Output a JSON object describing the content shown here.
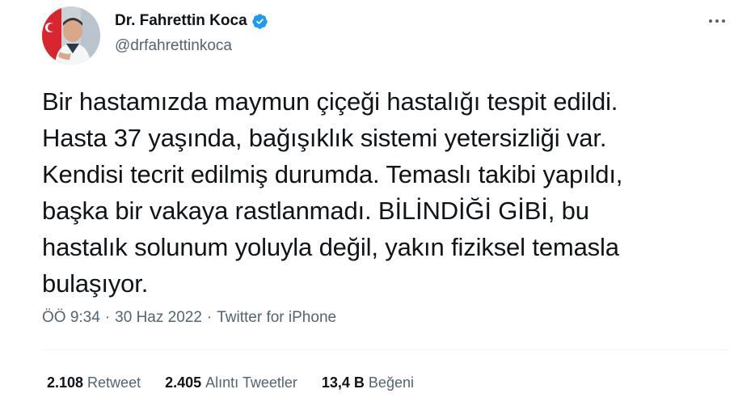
{
  "user": {
    "display_name": "Dr. Fahrettin Koca",
    "handle": "@drfahrettinkoca",
    "verified": true,
    "avatar_icon": "profile-photo"
  },
  "tweet": {
    "text": "Bir hastamızda maymun çiçeği hastalığı tespit edildi.\nHasta 37 yaşında, bağışıklık sistemi yetersizliği var.\nKendisi tecrit edilmiş durumda. Temaslı takibi yapıldı,\nbaşka bir vakaya rastlanmadı. BİLİNDİĞİ GİBİ, bu\nhastalık solunum yoluyla değil, yakın fiziksel temasla\nbulaşıyor.",
    "time": "ÖÖ 9:34",
    "date": "30 Haz 2022",
    "source": "Twitter for iPhone",
    "separator": "·"
  },
  "stats": {
    "retweets": {
      "count": "2.108",
      "label": "Retweet"
    },
    "quotes": {
      "count": "2.405",
      "label": "Alıntı Tweetler"
    },
    "likes": {
      "count": "13,4 B",
      "label": "Beğeni"
    }
  },
  "colors": {
    "text_primary": "#0f1419",
    "text_secondary": "#536471",
    "verified_blue": "#1d9bf0",
    "divider": "#eff3f4"
  },
  "icons": {
    "verified": "verified-badge-icon",
    "more": "more-options-icon"
  }
}
